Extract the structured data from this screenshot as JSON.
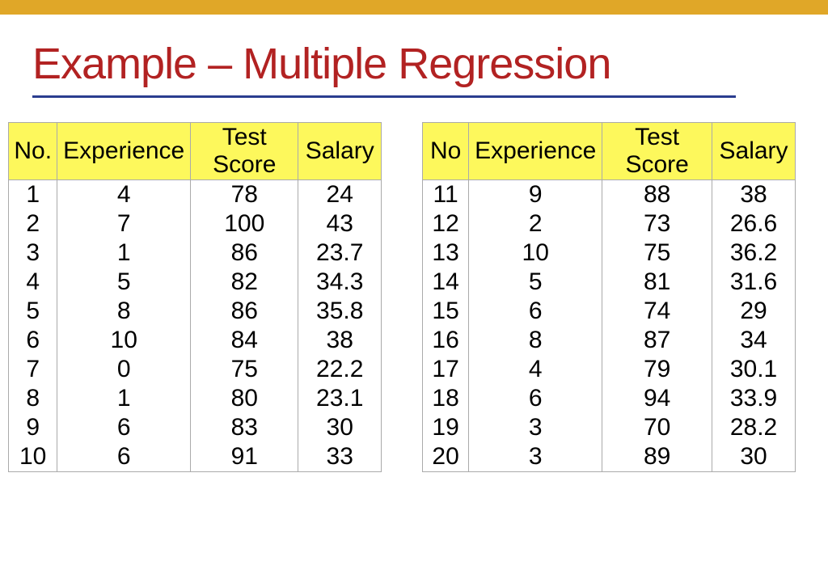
{
  "title": "Example – Multiple Regression",
  "table1": {
    "headers": {
      "no": "No.",
      "exp": "Experience",
      "test": "Test Score",
      "sal": "Salary"
    },
    "rows": [
      {
        "no": "1",
        "exp": "4",
        "test": "78",
        "sal": "24"
      },
      {
        "no": "2",
        "exp": "7",
        "test": "100",
        "sal": "43"
      },
      {
        "no": "3",
        "exp": "1",
        "test": "86",
        "sal": "23.7"
      },
      {
        "no": "4",
        "exp": "5",
        "test": "82",
        "sal": "34.3"
      },
      {
        "no": "5",
        "exp": "8",
        "test": "86",
        "sal": "35.8"
      },
      {
        "no": "6",
        "exp": "10",
        "test": "84",
        "sal": "38"
      },
      {
        "no": "7",
        "exp": "0",
        "test": "75",
        "sal": "22.2"
      },
      {
        "no": "8",
        "exp": "1",
        "test": "80",
        "sal": "23.1"
      },
      {
        "no": "9",
        "exp": "6",
        "test": "83",
        "sal": "30"
      },
      {
        "no": "10",
        "exp": "6",
        "test": "91",
        "sal": "33"
      }
    ]
  },
  "table2": {
    "headers": {
      "no": "No",
      "exp": "Experience",
      "test": "Test Score",
      "sal": "Salary"
    },
    "rows": [
      {
        "no": "11",
        "exp": "9",
        "test": "88",
        "sal": "38"
      },
      {
        "no": "12",
        "exp": "2",
        "test": "73",
        "sal": "26.6"
      },
      {
        "no": "13",
        "exp": "10",
        "test": "75",
        "sal": "36.2"
      },
      {
        "no": "14",
        "exp": "5",
        "test": "81",
        "sal": "31.6"
      },
      {
        "no": "15",
        "exp": "6",
        "test": "74",
        "sal": "29"
      },
      {
        "no": "16",
        "exp": "8",
        "test": "87",
        "sal": "34"
      },
      {
        "no": "17",
        "exp": "4",
        "test": "79",
        "sal": "30.1"
      },
      {
        "no": "18",
        "exp": "6",
        "test": "94",
        "sal": "33.9"
      },
      {
        "no": "19",
        "exp": "3",
        "test": "70",
        "sal": "28.2"
      },
      {
        "no": "20",
        "exp": "3",
        "test": "89",
        "sal": "30"
      }
    ]
  },
  "chart_data": {
    "type": "table",
    "title": "Example – Multiple Regression",
    "columns": [
      "No",
      "Experience",
      "Test Score",
      "Salary"
    ],
    "rows": [
      [
        1,
        4,
        78,
        24
      ],
      [
        2,
        7,
        100,
        43
      ],
      [
        3,
        1,
        86,
        23.7
      ],
      [
        4,
        5,
        82,
        34.3
      ],
      [
        5,
        8,
        86,
        35.8
      ],
      [
        6,
        10,
        84,
        38
      ],
      [
        7,
        0,
        75,
        22.2
      ],
      [
        8,
        1,
        80,
        23.1
      ],
      [
        9,
        6,
        83,
        30
      ],
      [
        10,
        6,
        91,
        33
      ],
      [
        11,
        9,
        88,
        38
      ],
      [
        12,
        2,
        73,
        26.6
      ],
      [
        13,
        10,
        75,
        36.2
      ],
      [
        14,
        5,
        81,
        31.6
      ],
      [
        15,
        6,
        74,
        29
      ],
      [
        16,
        8,
        87,
        34
      ],
      [
        17,
        4,
        79,
        30.1
      ],
      [
        18,
        6,
        94,
        33.9
      ],
      [
        19,
        3,
        70,
        28.2
      ],
      [
        20,
        3,
        89,
        30
      ]
    ]
  }
}
